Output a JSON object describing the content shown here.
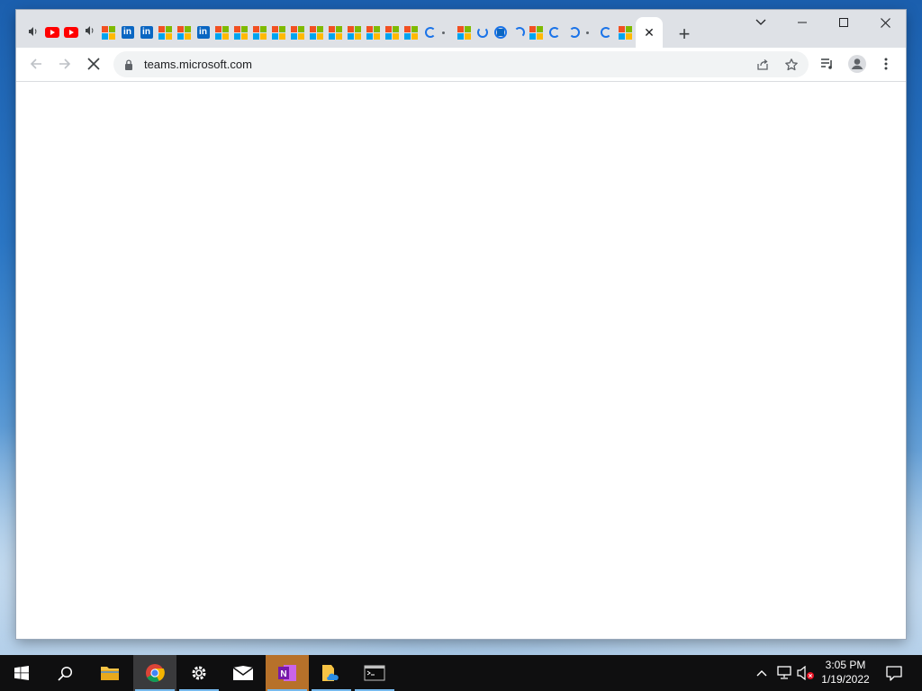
{
  "browser": {
    "url": "teams.microsoft.com",
    "active_tab_close": "✕",
    "new_tab": "+",
    "tabs": [
      {
        "icon": "speaker-icon"
      },
      {
        "icon": "youtube-icon"
      },
      {
        "icon": "youtube-icon"
      },
      {
        "icon": "speaker-icon"
      },
      {
        "icon": "microsoft-icon"
      },
      {
        "icon": "linkedin-icon"
      },
      {
        "icon": "linkedin-icon"
      },
      {
        "icon": "microsoft-icon"
      },
      {
        "icon": "microsoft-icon"
      },
      {
        "icon": "linkedin-icon"
      },
      {
        "icon": "microsoft-icon"
      },
      {
        "icon": "microsoft-icon"
      },
      {
        "icon": "microsoft-icon"
      },
      {
        "icon": "microsoft-icon"
      },
      {
        "icon": "microsoft-icon"
      },
      {
        "icon": "microsoft-icon"
      },
      {
        "icon": "microsoft-icon"
      },
      {
        "icon": "microsoft-icon"
      },
      {
        "icon": "microsoft-icon"
      },
      {
        "icon": "microsoft-icon"
      },
      {
        "icon": "loading-spinner-icon"
      },
      {
        "icon": "microsoft-icon"
      },
      {
        "icon": "loading-spinner-icon"
      },
      {
        "icon": "linkedin-icon"
      },
      {
        "icon": "loading-spinner-icon"
      },
      {
        "icon": "microsoft-icon"
      },
      {
        "icon": "loading-spinner-icon"
      },
      {
        "icon": "loading-spinner-icon"
      },
      {
        "icon": "loading-spinner-icon"
      },
      {
        "icon": "microsoft-icon"
      }
    ],
    "linkedin_letters": "in"
  },
  "taskbar": {
    "apps": [
      "start",
      "search",
      "file-explorer",
      "chrome",
      "settings",
      "mail",
      "onenote",
      "file-share",
      "command-prompt"
    ],
    "clock_time": "3:05 PM",
    "clock_date": "1/19/2022"
  },
  "colors": {
    "tabstrip": "#dee1e6",
    "accent": "#1a73e8",
    "taskbar": "#0f0f10"
  }
}
